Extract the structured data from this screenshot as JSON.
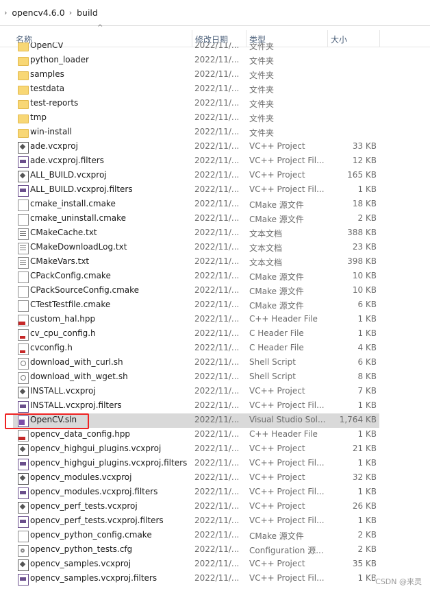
{
  "breadcrumb": [
    "opencv4.6.0",
    "build"
  ],
  "columns": {
    "name": "名称",
    "date": "修改日期",
    "type": "类型",
    "size": "大小"
  },
  "files": [
    {
      "name": "OpenCV",
      "date": "2022/11/...",
      "type": "文件夹",
      "size": "",
      "icon": "folder-icon"
    },
    {
      "name": "python_loader",
      "date": "2022/11/...",
      "type": "文件夹",
      "size": "",
      "icon": "folder-icon"
    },
    {
      "name": "samples",
      "date": "2022/11/...",
      "type": "文件夹",
      "size": "",
      "icon": "folder-icon"
    },
    {
      "name": "testdata",
      "date": "2022/11/...",
      "type": "文件夹",
      "size": "",
      "icon": "folder-icon"
    },
    {
      "name": "test-reports",
      "date": "2022/11/...",
      "type": "文件夹",
      "size": "",
      "icon": "folder-icon"
    },
    {
      "name": "tmp",
      "date": "2022/11/...",
      "type": "文件夹",
      "size": "",
      "icon": "folder-icon"
    },
    {
      "name": "win-install",
      "date": "2022/11/...",
      "type": "文件夹",
      "size": "",
      "icon": "folder-icon"
    },
    {
      "name": "ade.vcxproj",
      "date": "2022/11/...",
      "type": "VC++ Project",
      "size": "33 KB",
      "icon": "vcxproj-icon"
    },
    {
      "name": "ade.vcxproj.filters",
      "date": "2022/11/...",
      "type": "VC++ Project Fil...",
      "size": "12 KB",
      "icon": "filters-icon"
    },
    {
      "name": "ALL_BUILD.vcxproj",
      "date": "2022/11/...",
      "type": "VC++ Project",
      "size": "165 KB",
      "icon": "vcxproj-icon"
    },
    {
      "name": "ALL_BUILD.vcxproj.filters",
      "date": "2022/11/...",
      "type": "VC++ Project Fil...",
      "size": "1 KB",
      "icon": "filters-icon"
    },
    {
      "name": "cmake_install.cmake",
      "date": "2022/11/...",
      "type": "CMake 源文件",
      "size": "18 KB",
      "icon": "file-icon"
    },
    {
      "name": "cmake_uninstall.cmake",
      "date": "2022/11/...",
      "type": "CMake 源文件",
      "size": "2 KB",
      "icon": "file-icon"
    },
    {
      "name": "CMakeCache.txt",
      "date": "2022/11/...",
      "type": "文本文档",
      "size": "388 KB",
      "icon": "text-file-icon"
    },
    {
      "name": "CMakeDownloadLog.txt",
      "date": "2022/11/...",
      "type": "文本文档",
      "size": "23 KB",
      "icon": "text-file-icon"
    },
    {
      "name": "CMakeVars.txt",
      "date": "2022/11/...",
      "type": "文本文档",
      "size": "398 KB",
      "icon": "text-file-icon"
    },
    {
      "name": "CPackConfig.cmake",
      "date": "2022/11/...",
      "type": "CMake 源文件",
      "size": "10 KB",
      "icon": "file-icon"
    },
    {
      "name": "CPackSourceConfig.cmake",
      "date": "2022/11/...",
      "type": "CMake 源文件",
      "size": "10 KB",
      "icon": "file-icon"
    },
    {
      "name": "CTestTestfile.cmake",
      "date": "2022/11/...",
      "type": "CMake 源文件",
      "size": "6 KB",
      "icon": "file-icon"
    },
    {
      "name": "custom_hal.hpp",
      "date": "2022/11/...",
      "type": "C++ Header File",
      "size": "1 KB",
      "icon": "hpp-file-icon"
    },
    {
      "name": "cv_cpu_config.h",
      "date": "2022/11/...",
      "type": "C Header File",
      "size": "1 KB",
      "icon": "h-file-icon"
    },
    {
      "name": "cvconfig.h",
      "date": "2022/11/...",
      "type": "C Header File",
      "size": "4 KB",
      "icon": "h-file-icon"
    },
    {
      "name": "download_with_curl.sh",
      "date": "2022/11/...",
      "type": "Shell Script",
      "size": "6 KB",
      "icon": "shell-script-icon"
    },
    {
      "name": "download_with_wget.sh",
      "date": "2022/11/...",
      "type": "Shell Script",
      "size": "8 KB",
      "icon": "shell-script-icon"
    },
    {
      "name": "INSTALL.vcxproj",
      "date": "2022/11/...",
      "type": "VC++ Project",
      "size": "7 KB",
      "icon": "vcxproj-icon"
    },
    {
      "name": "INSTALL.vcxproj.filters",
      "date": "2022/11/...",
      "type": "VC++ Project Fil...",
      "size": "1 KB",
      "icon": "filters-icon"
    },
    {
      "name": "OpenCV.sln",
      "date": "2022/11/...",
      "type": "Visual Studio Sol...",
      "size": "1,764 KB",
      "icon": "solution-icon",
      "selected": true
    },
    {
      "name": "opencv_data_config.hpp",
      "date": "2022/11/...",
      "type": "C++ Header File",
      "size": "1 KB",
      "icon": "hpp-file-icon"
    },
    {
      "name": "opencv_highgui_plugins.vcxproj",
      "date": "2022/11/...",
      "type": "VC++ Project",
      "size": "21 KB",
      "icon": "vcxproj-icon"
    },
    {
      "name": "opencv_highgui_plugins.vcxproj.filters",
      "date": "2022/11/...",
      "type": "VC++ Project Fil...",
      "size": "1 KB",
      "icon": "filters-icon"
    },
    {
      "name": "opencv_modules.vcxproj",
      "date": "2022/11/...",
      "type": "VC++ Project",
      "size": "32 KB",
      "icon": "vcxproj-icon"
    },
    {
      "name": "opencv_modules.vcxproj.filters",
      "date": "2022/11/...",
      "type": "VC++ Project Fil...",
      "size": "1 KB",
      "icon": "filters-icon"
    },
    {
      "name": "opencv_perf_tests.vcxproj",
      "date": "2022/11/...",
      "type": "VC++ Project",
      "size": "26 KB",
      "icon": "vcxproj-icon"
    },
    {
      "name": "opencv_perf_tests.vcxproj.filters",
      "date": "2022/11/...",
      "type": "VC++ Project Fil...",
      "size": "1 KB",
      "icon": "filters-icon"
    },
    {
      "name": "opencv_python_config.cmake",
      "date": "2022/11/...",
      "type": "CMake 源文件",
      "size": "2 KB",
      "icon": "file-icon"
    },
    {
      "name": "opencv_python_tests.cfg",
      "date": "2022/11/...",
      "type": "Configuration 源...",
      "size": "2 KB",
      "icon": "config-file-icon"
    },
    {
      "name": "opencv_samples.vcxproj",
      "date": "2022/11/...",
      "type": "VC++ Project",
      "size": "35 KB",
      "icon": "vcxproj-icon"
    },
    {
      "name": "opencv_samples.vcxproj.filters",
      "date": "2022/11/...",
      "type": "VC++ Project Fil...",
      "size": "1 KB",
      "icon": "filters-icon"
    }
  ],
  "watermark": "CSDN @来灵"
}
